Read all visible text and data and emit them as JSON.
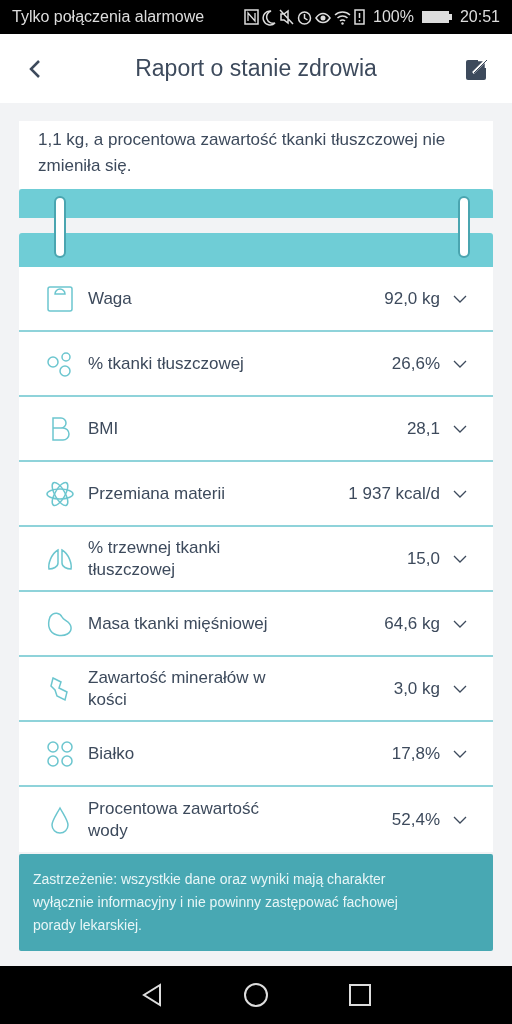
{
  "status_bar": {
    "carrier": "Tylko połączenia alarmowe",
    "battery": "100%",
    "time": "20:51"
  },
  "header": {
    "title": "Raport o stanie zdrowia"
  },
  "summary": {
    "text": "1,1 kg, a procentowa zawartość tkanki tłuszczowej nie zmieniła się."
  },
  "metrics": [
    {
      "label": "Waga",
      "value": "92,0 kg",
      "expanded": false
    },
    {
      "label": "% tkanki tłuszczowej",
      "value": "26,6%",
      "expanded": false
    },
    {
      "label": "BMI",
      "value": "28,1",
      "expanded": false
    },
    {
      "label": "Przemiana materii",
      "value": "1 937 kcal/d",
      "expanded": false
    },
    {
      "label": "% trzewnej tkanki tłuszczowej",
      "value": "15,0",
      "expanded": false
    },
    {
      "label": "Masa tkanki mięśniowej",
      "value": "64,6 kg",
      "expanded": false
    },
    {
      "label": "Zawartość minerałów w kości",
      "value": "3,0 kg",
      "expanded": false
    },
    {
      "label": "Białko",
      "value": "17,8%",
      "expanded": false
    },
    {
      "label": "Procentowa zawartość wody",
      "value": "52,4%",
      "expanded": false
    }
  ],
  "disclaimer": "Zastrzeżenie: wszystkie dane oraz wyniki mają charakter wyłącznie informacyjny i nie powinny zastępować fachowej porady lekarskiej."
}
